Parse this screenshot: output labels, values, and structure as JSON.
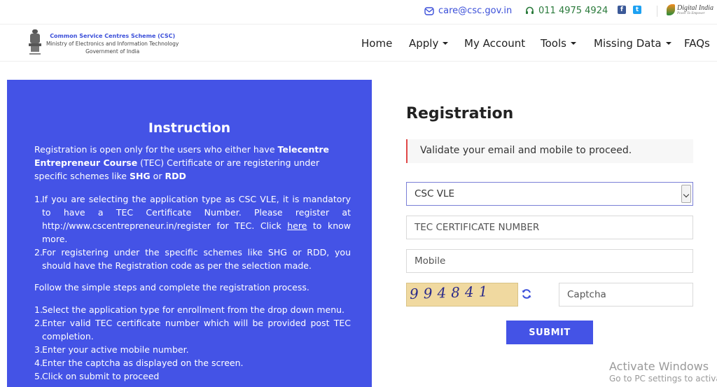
{
  "topbar": {
    "email": "care@csc.gov.in",
    "phone": "011 4975 4924",
    "digital_india": "Digital India",
    "digital_india_sub": "Power To Empower"
  },
  "header": {
    "brand_line1": "Common Service Centres Scheme (CSC)",
    "brand_line2": "Ministry of Electronics and Information Technology",
    "brand_line3": "Government of India",
    "nav": [
      {
        "label": "Home",
        "dropdown": false
      },
      {
        "label": "Apply",
        "dropdown": true
      },
      {
        "label": "My Account",
        "dropdown": false
      },
      {
        "label": "Tools",
        "dropdown": true
      },
      {
        "label": "Missing Data",
        "dropdown": true
      },
      {
        "label": "FAQs",
        "dropdown": false
      }
    ]
  },
  "instruction": {
    "title": "Instruction",
    "intro_a": "Registration is open only for the users who either have ",
    "intro_b": "Telecentre Entrepreneur Course",
    "intro_c": " (TEC) Certificate or are registering under specific schemes like ",
    "intro_d": "SHG",
    "intro_e": " or ",
    "intro_f": "RDD",
    "list1": [
      {
        "num": "1.",
        "text_a": "If you are selecting the application type as CSC VLE, it is mandatory to have a TEC Certificate Number. Please register at http://www.cscentrepreneur.in/register for TEC. Click ",
        "link": "here",
        "text_b": " to know more."
      },
      {
        "num": "2.",
        "text_a": "For registering under the specific schemes like SHG or RDD, you should have the Registration code as per the selection made.",
        "link": "",
        "text_b": ""
      }
    ],
    "follow": "Follow the simple steps and complete the registration process.",
    "list2": [
      {
        "num": "1.",
        "text": "Select the application type for enrollment from the drop down menu."
      },
      {
        "num": "2.",
        "text": "Enter valid TEC certificate number which will be provided post TEC completion."
      },
      {
        "num": "3.",
        "text": "Enter your active mobile number."
      },
      {
        "num": "4.",
        "text": "Enter the captcha as displayed on the screen."
      },
      {
        "num": "5.",
        "text": "Click on submit to proceed"
      }
    ]
  },
  "form": {
    "title": "Registration",
    "alert": "Validate your email and mobile to proceed.",
    "app_type": "CSC VLE",
    "tec_placeholder": "TEC CERTIFICATE NUMBER",
    "mobile_placeholder": "Mobile",
    "captcha_text": "994841",
    "captcha_placeholder": "Captcha",
    "submit_label": "SUBMIT"
  },
  "watermark": {
    "line1": "Activate Windows",
    "line2": "Go to PC settings to activa"
  },
  "colors": {
    "accent": "#4453e6",
    "alert_border": "#e04848",
    "captcha_bg": "#f0d9a0"
  }
}
